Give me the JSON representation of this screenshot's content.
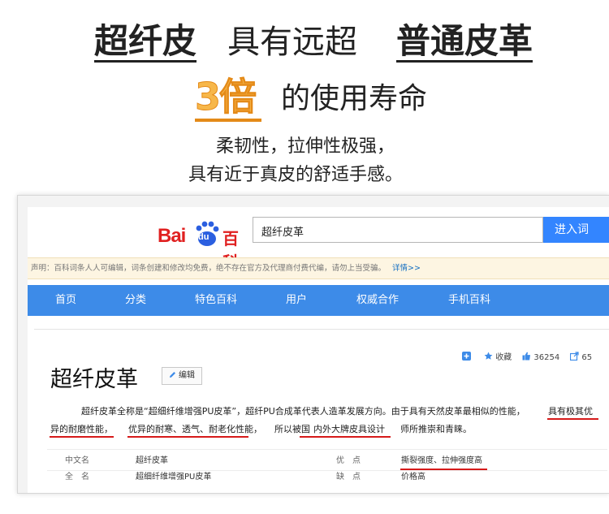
{
  "headline": {
    "line1_a": "超纤皮",
    "line1_b": "具有远超",
    "line1_c": "普通皮革",
    "line2_number": "3倍",
    "line2_tail": "的使用寿命",
    "line3": "柔韧性，拉伸性极强，",
    "line4": "具有近于真皮的舒适手感。"
  },
  "colors": {
    "accent_orange": "#f7b74a",
    "baidu_red": "#e02020",
    "baidu_blue": "#3d8be8",
    "underline_red": "#d61a1a"
  },
  "baike": {
    "logo": {
      "bai": "Bai",
      "du": "du",
      "baike": "百科"
    },
    "search": {
      "value": "超纤皮革",
      "button_label": "进入词"
    },
    "notice": {
      "text": "声明：百科词条人人可编辑，词条创建和修改均免费，绝不存在官方及代理商付费代编，请勿上当受骗。",
      "link": "详情>>"
    },
    "nav": [
      "首页",
      "分类",
      "特色百科",
      "用户",
      "权威合作",
      "手机百科"
    ],
    "tools": {
      "collect": "收藏",
      "likes": "36254",
      "share": "65"
    },
    "entry": {
      "title": "超纤皮革",
      "edit_label": "编辑",
      "para_1a": "超纤皮革全称是“超细纤维增强PU皮革”，超纤PU合成革代表人造革发展方向。由于具有天然皮革最相似的性能，",
      "para_1b": "具有极其优",
      "para_2a": "异的耐磨性能，",
      "para_2b": "优异的耐寒、透气、耐老化性能，",
      "para_2c": "所以被国",
      "para_2d": "内外大牌皮具设计",
      "para_2e": "师所推崇和青睐。"
    },
    "infobox": [
      {
        "key": "中文名",
        "value": "超纤皮革",
        "key2": "优　点",
        "value2": "撕裂强度、拉伸强度高"
      },
      {
        "key": "全　名",
        "value": "超细纤维增强PU皮革",
        "key2": "缺　点",
        "value2": "价格高"
      }
    ]
  }
}
